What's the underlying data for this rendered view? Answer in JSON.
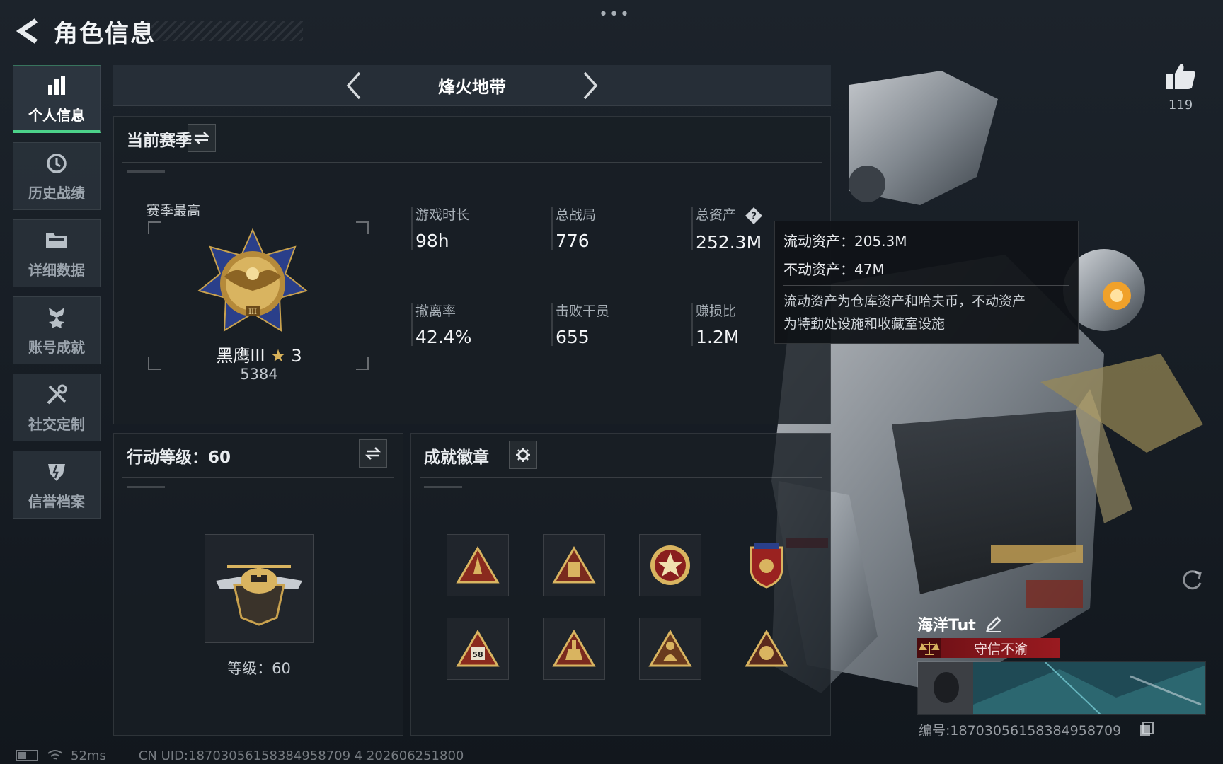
{
  "header": {
    "title": "角色信息",
    "back_icon": "back-arrow-icon",
    "more_dots": "•••"
  },
  "nav": {
    "items": [
      {
        "label": "个人信息",
        "icon": "bar-chart-icon",
        "active": true
      },
      {
        "label": "历史战绩",
        "icon": "clock-history-icon",
        "active": false
      },
      {
        "label": "详细数据",
        "icon": "folder-icon",
        "active": false
      },
      {
        "label": "账号成就",
        "icon": "achievement-medal-icon",
        "active": false
      },
      {
        "label": "社交定制",
        "icon": "wrench-screwdriver-icon",
        "active": false
      },
      {
        "label": "信誉档案",
        "icon": "shield-credit-icon",
        "active": false
      }
    ]
  },
  "mode": {
    "title": "烽火地带"
  },
  "season": {
    "title": "当前赛季",
    "best_label": "赛季最高",
    "rank_name": "黑鹰III",
    "rank_star": "★",
    "rank_stars": "3",
    "rank_score": "5384",
    "stats": [
      {
        "label": "游戏时长",
        "value": "98h"
      },
      {
        "label": "总战局",
        "value": "776"
      },
      {
        "label": "总资产",
        "value": "252.3M"
      },
      {
        "label": "撤离率",
        "value": "42.4%"
      },
      {
        "label": "击败干员",
        "value": "655"
      },
      {
        "label": "赚损比",
        "value": "1.2M"
      }
    ]
  },
  "tooltip": {
    "liquid": "流动资产：205.3M",
    "fixed": "不动资产：47M",
    "desc_line1": "流动资产为仓库资产和哈夫币，不动资产",
    "desc_line2": "为特勤处设施和收藏室设施"
  },
  "action_level": {
    "title": "行动等级：60",
    "level_text": "等级：60"
  },
  "badges": {
    "title": "成就徽章",
    "items": [
      "badge-rocket-icon",
      "badge-bunker-icon",
      "badge-star-seal-icon",
      "badge-shield-crest-icon",
      "badge-58-icon",
      "badge-tower-icon",
      "badge-figure-icon",
      "badge-emblem-icon"
    ]
  },
  "like": {
    "count": "119"
  },
  "player": {
    "name": "海洋Tut",
    "credit": "守信不渝",
    "id": "编号:18703056158384958709"
  },
  "status": {
    "ping": "52ms",
    "uid": "CN UID:18703056158384958709 4 202606251800"
  },
  "colors": {
    "accent_green": "#4cd28a",
    "gold": "#d8b25a",
    "credit_red": "#9a1a20"
  }
}
